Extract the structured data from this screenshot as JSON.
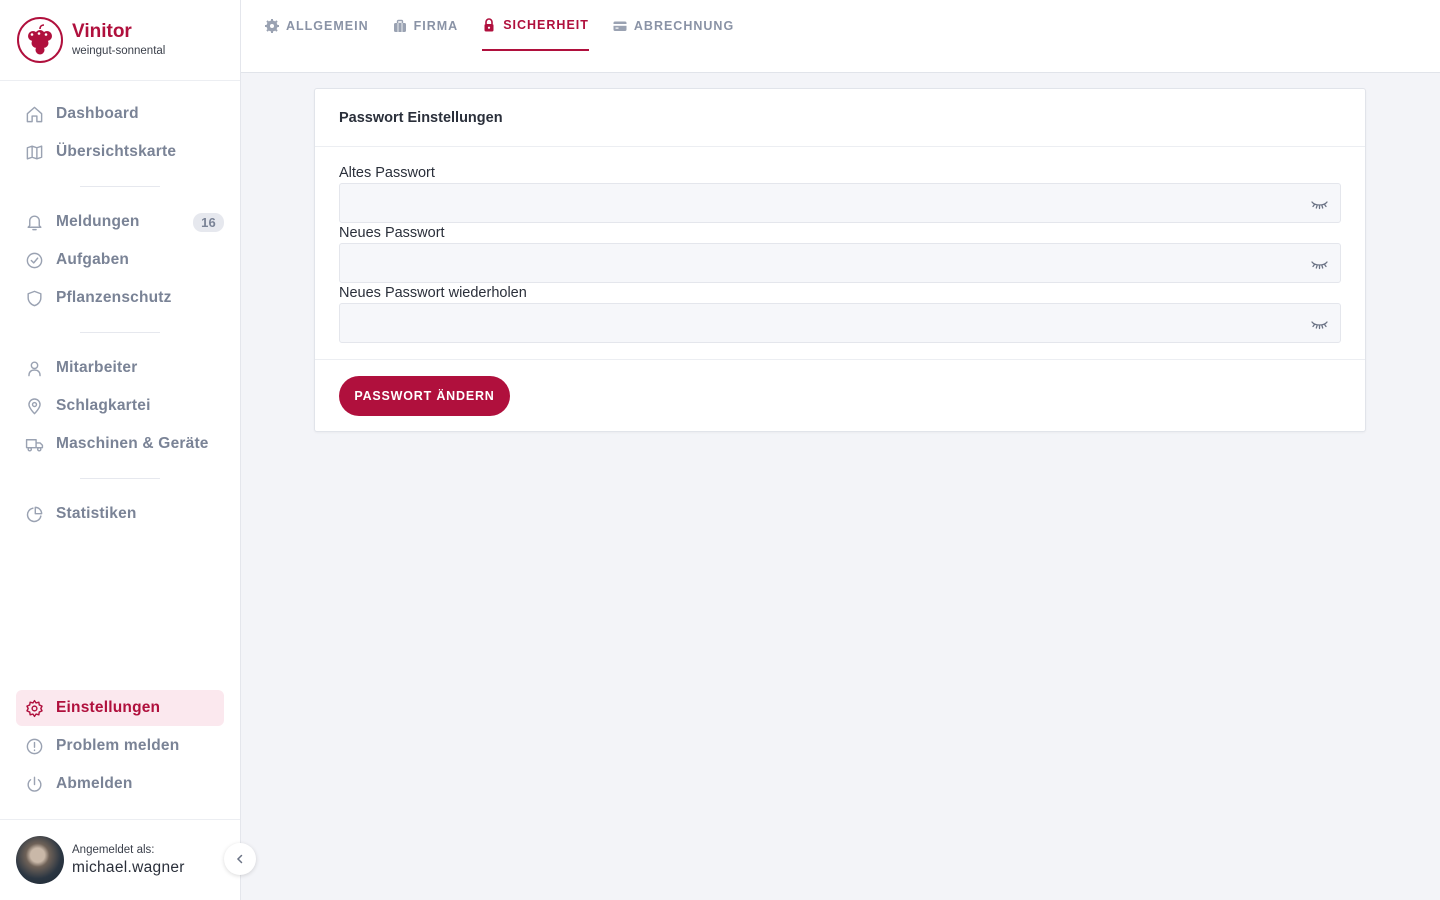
{
  "brand": {
    "name": "Vinitor",
    "subtitle": "weingut-sonnental",
    "accent": "#b0103d"
  },
  "sidebar": {
    "group1": [
      {
        "label": "Dashboard",
        "icon": "home-icon"
      },
      {
        "label": "Übersichtskarte",
        "icon": "map-icon"
      }
    ],
    "group2": [
      {
        "label": "Meldungen",
        "icon": "bell-icon",
        "badge": "16"
      },
      {
        "label": "Aufgaben",
        "icon": "check-circle-icon"
      },
      {
        "label": "Pflanzenschutz",
        "icon": "shield-icon"
      }
    ],
    "group3": [
      {
        "label": "Mitarbeiter",
        "icon": "user-icon"
      },
      {
        "label": "Schlagkartei",
        "icon": "map-pin-icon"
      },
      {
        "label": "Maschinen & Geräte",
        "icon": "truck-icon"
      }
    ],
    "group4": [
      {
        "label": "Statistiken",
        "icon": "pie-chart-icon"
      }
    ],
    "bottom": [
      {
        "label": "Einstellungen",
        "icon": "gear-icon",
        "active": true
      },
      {
        "label": "Problem melden",
        "icon": "alert-circle-icon"
      },
      {
        "label": "Abmelden",
        "icon": "power-icon"
      }
    ]
  },
  "user": {
    "label": "Angemeldet als:",
    "name": "michael.wagner"
  },
  "tabs": [
    {
      "label": "ALLGEMEIN",
      "icon": "cog-icon"
    },
    {
      "label": "FIRMA",
      "icon": "briefcase-icon"
    },
    {
      "label": "SICHERHEIT",
      "icon": "lock-icon",
      "active": true
    },
    {
      "label": "ABRECHNUNG",
      "icon": "credit-card-icon"
    }
  ],
  "card": {
    "title": "Passwort Einstellungen",
    "fields": [
      {
        "label": "Altes Passwort",
        "value": ""
      },
      {
        "label": "Neues Passwort",
        "value": ""
      },
      {
        "label": "Neues Passwort wiederholen",
        "value": ""
      }
    ],
    "submit_label": "PASSWORT ÄNDERN"
  }
}
